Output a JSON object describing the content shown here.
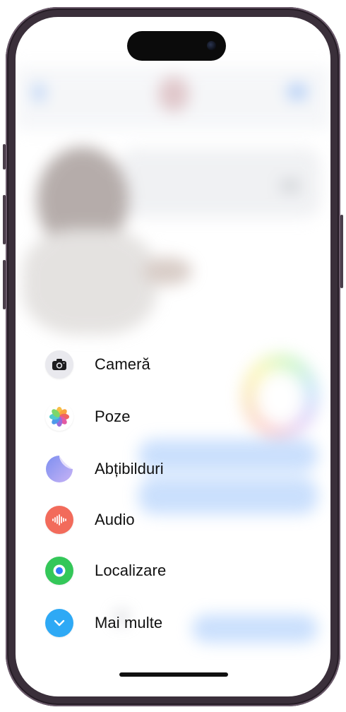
{
  "menu": {
    "items": [
      {
        "label": "Cameră",
        "icon": "camera-icon",
        "color": "#e9e9ee"
      },
      {
        "label": "Poze",
        "icon": "photos-icon",
        "color": "#ffffff"
      },
      {
        "label": "Abțibilduri",
        "icon": "stickers-icon",
        "color": "#b9c5f5"
      },
      {
        "label": "Audio",
        "icon": "audio-waveform-icon",
        "color": "#f26b5b"
      },
      {
        "label": "Localizare",
        "icon": "location-icon",
        "color": "#34c759"
      },
      {
        "label": "Mai multe",
        "icon": "chevron-down-icon",
        "color": "#2ea9f5"
      }
    ]
  }
}
